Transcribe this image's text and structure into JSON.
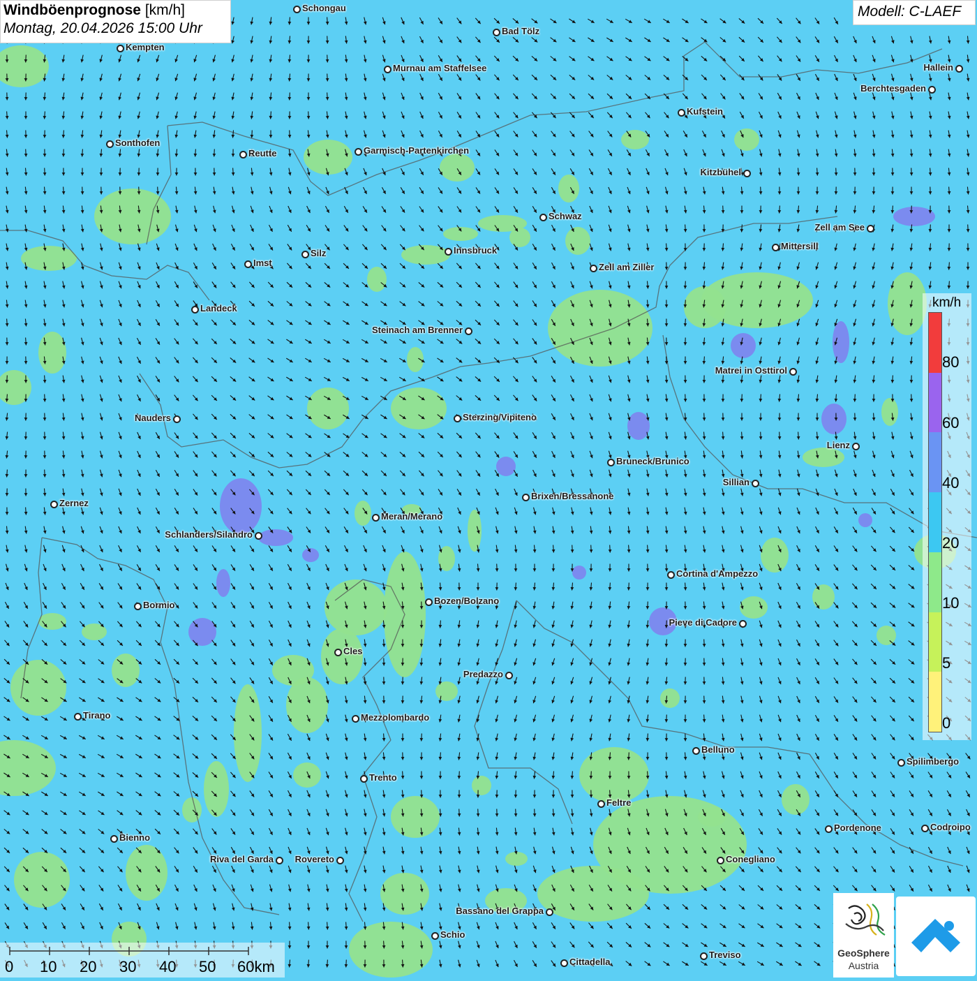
{
  "header": {
    "title": "Windböenprognose",
    "unit": "[km/h]",
    "datetime": "Montag, 20.04.2026 15:00 Uhr",
    "model": "Modell: C-LAEF"
  },
  "legend": {
    "unit": "km/h",
    "ticks": [
      "80",
      "60",
      "40",
      "20",
      "10",
      "5",
      "0"
    ],
    "colors": [
      "#f23c3c",
      "#9a64ee",
      "#6a94f3",
      "#3cc8f2",
      "#8ee98a",
      "#c6f25a",
      "#fff27a"
    ]
  },
  "scale_bar": {
    "labels": [
      "0",
      "10",
      "20",
      "30",
      "40",
      "50",
      "60km"
    ]
  },
  "logos": {
    "geosphere_line1": "GeoSphere",
    "geosphere_line2": "Austria",
    "app_icon": "wind-app-logo-icon"
  },
  "colors": {
    "background": "#5ccff4",
    "calm": "#93e28e",
    "strong": "#7e83ee",
    "border": "#555555",
    "arrow": "#111111"
  },
  "cities": [
    "Schongau",
    "Bad Tölz",
    "Kempten",
    "Murnau am Staffelsee",
    "Hallein",
    "Berchtesgaden",
    "Kufstein",
    "Sonthofen",
    "Reutte",
    "Garmisch-Partenkirchen",
    "Kitzbühel",
    "Schwaz",
    "Zell am See",
    "Innsbruck",
    "Mittersill",
    "Silz",
    "Imst",
    "Zell am Ziller",
    "Landeck",
    "Steinach am Brenner",
    "Matrei in Osttirol",
    "Nauders",
    "Sterzing/Vipiteno",
    "Lienz",
    "Bruneck/Brunico",
    "Sillian",
    "Zernez",
    "Brixen/Bressanone",
    "Meran/Merano",
    "Schlanders/Silandro",
    "Cortina d'Ampezzo",
    "Bozen/Bolzano",
    "Bormio",
    "Pieve di Cadore",
    "Cles",
    "Predazzo",
    "Tirano",
    "Mezzolombardo",
    "Belluno",
    "Spilimbergo",
    "Trento",
    "Feltre",
    "Bienno",
    "Pordenone",
    "Codroipo",
    "Riva del Garda",
    "Rovereto",
    "Conegliano",
    "Bassano del Grappa",
    "Schio",
    "Treviso",
    "Cittadella"
  ]
}
